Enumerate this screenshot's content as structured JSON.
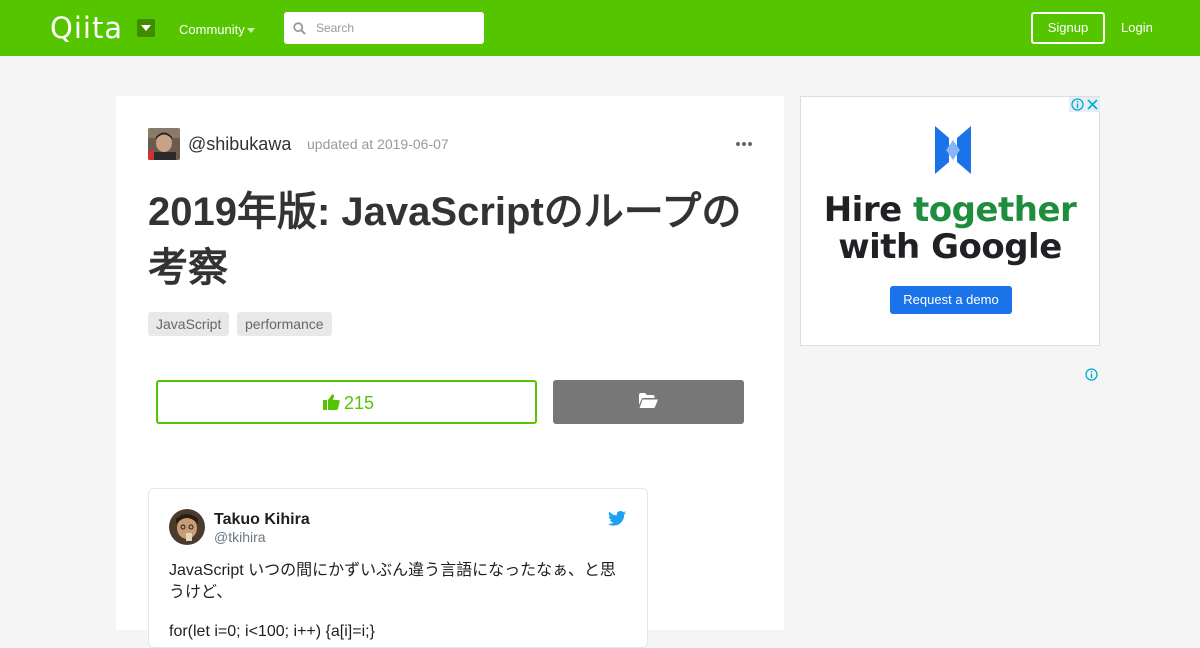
{
  "header": {
    "logo_text": "Qiita",
    "community_label": "Community",
    "search": {
      "placeholder": "Search",
      "value": ""
    },
    "signup_label": "Signup",
    "login_label": "Login",
    "brand_color": "#55c500"
  },
  "article": {
    "author": "@shibukawa",
    "updated": "updated at 2019-06-07",
    "title": "2019年版: JavaScriptのループの考察",
    "tags": [
      "JavaScript",
      "performance"
    ],
    "like_count": "215",
    "tweet": {
      "name": "Takuo Kihira",
      "handle": "@tkihira",
      "text_line1": "JavaScript いつの間にかずいぶん違う言語になったなぁ、と思うけど、",
      "text_line2": "for(let i=0; i<100; i++) {a[i]=i;}"
    }
  },
  "ad": {
    "headline_line1_a": "Hire ",
    "headline_line1_b": "together",
    "headline_line2": "with Google",
    "cta": "Request a demo"
  },
  "icons": {
    "search": "search-icon",
    "like": "thumbs-up-icon",
    "stock": "folder-open-icon",
    "more": "more-icon",
    "twitter": "twitter-bird-icon"
  }
}
